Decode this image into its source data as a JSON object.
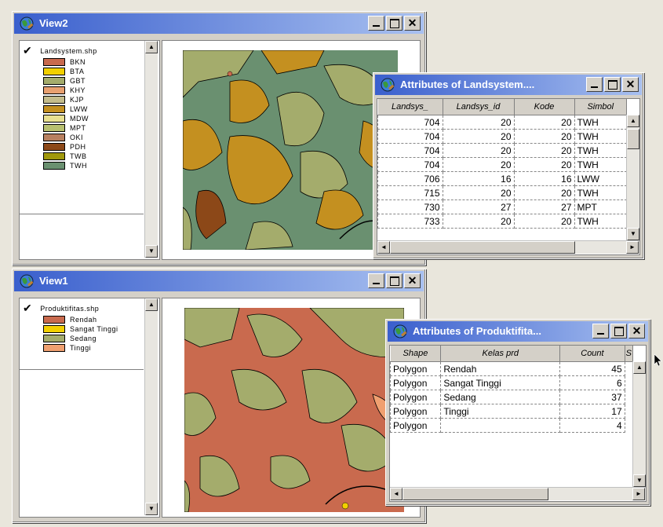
{
  "view2": {
    "title": "View2",
    "layer": "Landsystem.shp",
    "legend": [
      {
        "label": "BKN",
        "color": "#c96a4e"
      },
      {
        "label": "BTA",
        "color": "#f2d000"
      },
      {
        "label": "GBT",
        "color": "#a4ac6c"
      },
      {
        "label": "KHY",
        "color": "#e8a070"
      },
      {
        "label": "KJP",
        "color": "#c4bc8c"
      },
      {
        "label": "LWW",
        "color": "#c49020"
      },
      {
        "label": "MDW",
        "color": "#e8e090"
      },
      {
        "label": "MPT",
        "color": "#b8c070"
      },
      {
        "label": "OKI",
        "color": "#b88060"
      },
      {
        "label": "PDH",
        "color": "#8c4818"
      },
      {
        "label": "TWB",
        "color": "#a0980c"
      },
      {
        "label": "TWH",
        "color": "#6a9070"
      }
    ]
  },
  "attr_land": {
    "title": "Attributes of Landsystem....",
    "columns": [
      "Landsys_",
      "Landsys_id",
      "Kode",
      "Simbol"
    ],
    "rows": [
      [
        "704",
        "20",
        "20",
        "TWH"
      ],
      [
        "704",
        "20",
        "20",
        "TWH"
      ],
      [
        "704",
        "20",
        "20",
        "TWH"
      ],
      [
        "704",
        "20",
        "20",
        "TWH"
      ],
      [
        "706",
        "16",
        "16",
        "LWW"
      ],
      [
        "715",
        "20",
        "20",
        "TWH"
      ],
      [
        "730",
        "27",
        "27",
        "MPT"
      ],
      [
        "733",
        "20",
        "20",
        "TWH"
      ]
    ]
  },
  "view1": {
    "title": "View1",
    "layer": "Produktifitas.shp",
    "legend": [
      {
        "label": "Rendah",
        "color": "#c96a4e"
      },
      {
        "label": "Sangat Tinggi",
        "color": "#f2d000"
      },
      {
        "label": "Sedang",
        "color": "#a4ac6c"
      },
      {
        "label": "Tinggi",
        "color": "#f0a070"
      }
    ]
  },
  "attr_prod": {
    "title": "Attributes of Produktifita...",
    "columns": [
      "Shape",
      "Kelas prd",
      "Count",
      "S"
    ],
    "rows": [
      [
        "Polygon",
        "Rendah",
        "45"
      ],
      [
        "Polygon",
        "Sangat Tinggi",
        "6"
      ],
      [
        "Polygon",
        "Sedang",
        "37"
      ],
      [
        "Polygon",
        "Tinggi",
        "17"
      ],
      [
        "Polygon",
        "",
        "4"
      ]
    ]
  },
  "icons": [
    "globe-icon",
    "checkmark-icon",
    "minimize-icon",
    "maximize-icon",
    "close-icon",
    "scroll-up-icon",
    "scroll-down-icon",
    "scroll-left-icon",
    "scroll-right-icon",
    "mouse-cursor-icon"
  ]
}
